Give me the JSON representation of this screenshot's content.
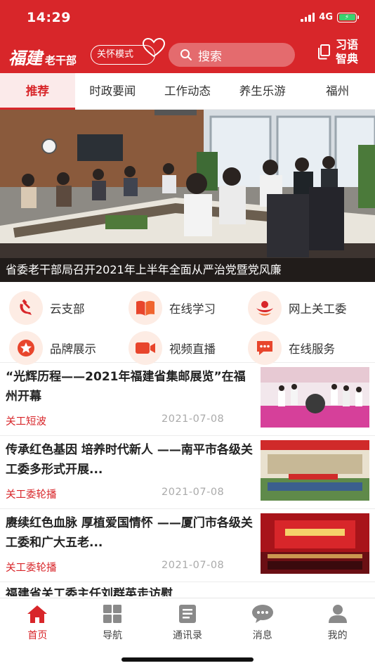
{
  "status_bar": {
    "time": "14:29",
    "network": "4G"
  },
  "header": {
    "logo_script": "福建",
    "logo_sub": "老干部",
    "care_mode": "关怀模式",
    "search_placeholder": "搜索",
    "xiyu_line1": "习语",
    "xiyu_line2": "智典"
  },
  "tabs": [
    {
      "label": "推荐",
      "active": true
    },
    {
      "label": "时政要闻"
    },
    {
      "label": "工作动态"
    },
    {
      "label": "养生乐游"
    },
    {
      "label": "福州"
    }
  ],
  "banner": {
    "caption": "省委老干部局召开2021年上半年全面从严治党暨党风廉"
  },
  "grid": [
    {
      "label": "云支部",
      "icon": "party-emblem-icon"
    },
    {
      "label": "在线学习",
      "icon": "book-icon"
    },
    {
      "label": "网上关工委",
      "icon": "guangongwei-logo-icon"
    },
    {
      "label": "品牌展示",
      "icon": "star-icon"
    },
    {
      "label": "视频直播",
      "icon": "video-icon"
    },
    {
      "label": "在线服务",
      "icon": "chat-icon"
    }
  ],
  "news": [
    {
      "title": "“光辉历程——2021年福建省集邮展览”在福州开幕",
      "source": "关工短波",
      "date": "2021-07-08"
    },
    {
      "title": "传承红色基因 培养时代新人 ——南平市各级关工委多形式开展...",
      "source": "关工委轮播",
      "date": "2021-07-08"
    },
    {
      "title": "赓续红色血脉 厚植爱国情怀 ——厦门市各级关工委和广大五老...",
      "source": "关工委轮播",
      "date": "2021-07-08"
    },
    {
      "title": "福建省关工委主任刘群英走访慰"
    }
  ],
  "tabbar": [
    {
      "label": "首页",
      "icon": "home-icon",
      "active": true
    },
    {
      "label": "导航",
      "icon": "grid-icon"
    },
    {
      "label": "通讯录",
      "icon": "contacts-icon"
    },
    {
      "label": "消息",
      "icon": "message-icon"
    },
    {
      "label": "我的",
      "icon": "user-icon"
    }
  ],
  "colors": {
    "brand_red": "#d8262a",
    "icon_bg": "#fdece4",
    "date_gray": "#aaaaaa"
  }
}
